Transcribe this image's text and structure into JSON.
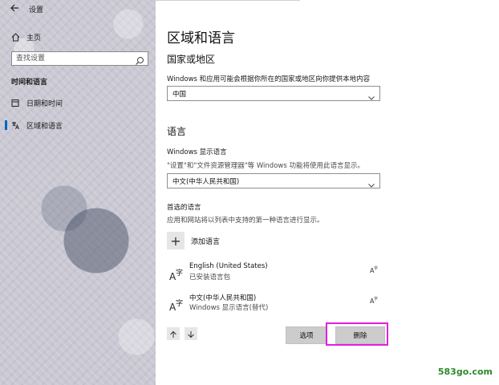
{
  "window": {
    "title": "设置"
  },
  "nav": {
    "home_label": "主页",
    "search_placeholder": "查找设置",
    "section_title": "时间和语言",
    "items": [
      {
        "label": "日期和时间",
        "icon": "calendar-clock-icon",
        "active": false
      },
      {
        "label": "区域和语言",
        "icon": "region-language-icon",
        "active": true
      }
    ]
  },
  "page": {
    "title": "区域和语言",
    "country_section": {
      "heading": "国家或地区",
      "description": "Windows 和应用可能会根据你所在的国家或地区向你提供本地内容",
      "selected": "中国"
    },
    "language_section": {
      "heading": "语言",
      "display_language_label": "Windows 显示语言",
      "display_language_desc": "\"设置\"和\"文件资源管理器\"等 Windows 功能将使用此语言显示。",
      "display_language_selected": "中文(中华人民共和国)",
      "preferred_label": "首选的语言",
      "preferred_desc": "应用和网站将以列表中支持的第一种语言进行显示。",
      "add_label": "添加语言",
      "languages": [
        {
          "name": "English (United States)",
          "status": "已安装语言包"
        },
        {
          "name": "中文(中华人民共和国)",
          "status": "Windows 显示语言(替代)"
        }
      ]
    },
    "buttons": {
      "options": "选项",
      "remove": "删除"
    }
  },
  "colors": {
    "accent": "#0067c0",
    "highlight": "#e020e0",
    "watermark": "#2b8a2b"
  },
  "watermark": "583go.com"
}
